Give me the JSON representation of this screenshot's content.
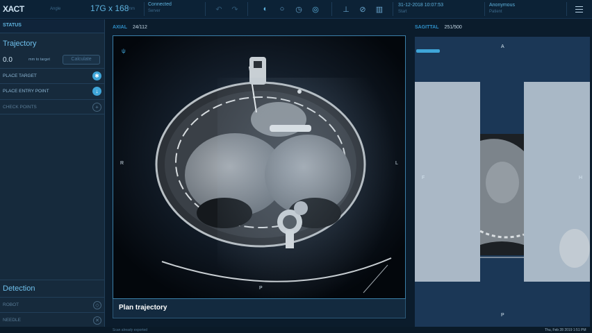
{
  "topbar": {
    "logo": "XACT",
    "angle_label": "Angle",
    "dims_value": "17G x 168",
    "dims_unit": "mm",
    "connection_status": "Connected",
    "connection_sub": "Server",
    "date_time": "31-12-2018 10:07:53",
    "date_sub": "Start",
    "patient_name": "Anonymous",
    "patient_sub": "Patient"
  },
  "left_panel": {
    "status_label": "STATUS",
    "trajectory_title": "Trajectory",
    "distance_value": "0.0",
    "distance_label": "mm to target",
    "calculate_label": "Calculate",
    "rows": [
      {
        "label": "PLACE TARGET",
        "icon": "target-icon"
      },
      {
        "label": "PLACE ENTRY POINT",
        "icon": "arrow-down-icon"
      },
      {
        "label": "CHECK POINTS",
        "icon": "plus-icon"
      }
    ],
    "detection_title": "Detection",
    "detection_rows": [
      {
        "label": "ROBOT",
        "icon": "shield-icon"
      },
      {
        "label": "NEEDLE",
        "icon": "close-icon"
      }
    ]
  },
  "axial_view": {
    "name": "AXIAL",
    "index": "24/112",
    "orient_r": "R",
    "orient_l": "L",
    "orient_p": "P",
    "plan_label": "Plan trajectory"
  },
  "sagittal_view": {
    "name": "SAGITTAL",
    "index": "251/500",
    "orient_a": "A",
    "orient_f": "F",
    "orient_h": "H",
    "orient_p": "P"
  },
  "footer": {
    "left_text": "Scan already exported",
    "right_text": "Thu, Feb 28 2019 1:51 PM"
  }
}
